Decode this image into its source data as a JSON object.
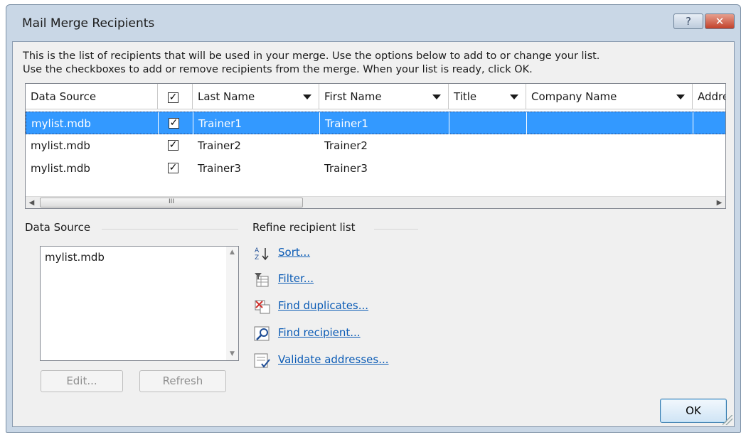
{
  "window": {
    "title": "Mail Merge Recipients",
    "help_label": "?",
    "close_label": "✕"
  },
  "intro": {
    "line1": "This is the list of recipients that will be used in your merge.  Use the options below to add to or change your list.",
    "line2": "Use the checkboxes to add or remove recipients from the merge.  When your list is ready, click OK."
  },
  "grid": {
    "columns": [
      "Data Source",
      "",
      "Last Name",
      "First Name",
      "Title",
      "Company Name",
      "Address"
    ],
    "header_checkbox": "✓",
    "rows": [
      {
        "source": "mylist.mdb",
        "checked": "✓",
        "last": "Trainer1",
        "first": "Trainer1",
        "selected": true
      },
      {
        "source": "mylist.mdb",
        "checked": "✓",
        "last": "Trainer2",
        "first": "Trainer2",
        "selected": false
      },
      {
        "source": "mylist.mdb",
        "checked": "✓",
        "last": "Trainer3",
        "first": "Trainer3",
        "selected": false
      }
    ],
    "scroll_left": "◀",
    "scroll_right": "▶",
    "scroll_grip": "III"
  },
  "data_source": {
    "label": "Data Source",
    "items": [
      "mylist.mdb"
    ],
    "edit_label": "Edit...",
    "refresh_label": "Refresh",
    "scroll_up": "▲",
    "scroll_down": "▼"
  },
  "refine": {
    "label": "Refine recipient list",
    "items": [
      {
        "label": "Sort...",
        "icon": "sort-az-icon"
      },
      {
        "label": "Filter...",
        "icon": "filter-icon"
      },
      {
        "label": "Find duplicates...",
        "icon": "find-duplicates-icon"
      },
      {
        "label": "Find recipient...",
        "icon": "find-recipient-icon"
      },
      {
        "label": "Validate addresses...",
        "icon": "validate-addresses-icon"
      }
    ]
  },
  "ok_label": "OK",
  "colors": {
    "selection": "#3399ff",
    "link": "#0b5bb5",
    "window_frame": "#c9d7e6"
  }
}
